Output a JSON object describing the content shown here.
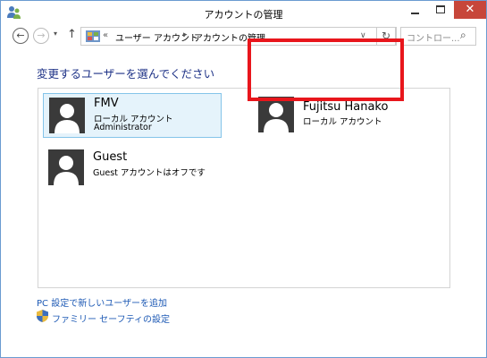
{
  "window": {
    "title": "アカウントの管理",
    "close_glyph": "✕"
  },
  "nav": {
    "back_glyph": "←",
    "forward_glyph": "→",
    "dropdown_glyph": "▾",
    "up_glyph": "↑",
    "breadcrumb_sep": "«",
    "breadcrumb": [
      "ユーザー アカウント",
      "アカウントの管理"
    ],
    "crumb_sep": "▸",
    "address_dropdown": "∨",
    "refresh_glyph": "↻",
    "search_placeholder": "コントロー...",
    "search_glyph": "⌕"
  },
  "main": {
    "heading": "変更するユーザーを選んでください",
    "users": [
      {
        "name": "FMV",
        "type": "ローカル アカウント",
        "role": "Administrator",
        "selected": true
      },
      {
        "name": "Fujitsu Hanako",
        "type": "ローカル アカウント",
        "role": "",
        "highlighted": true
      },
      {
        "name": "Guest",
        "type": "Guest アカウントはオフです",
        "role": ""
      }
    ],
    "links": {
      "add_user": "PC 設定で新しいユーザーを追加",
      "family_safety": "ファミリー セーフティの設定"
    }
  },
  "colors": {
    "heading": "#1e3287",
    "link": "#1e5ab5",
    "selected_bg": "#e5f3fb",
    "selected_border": "#84c4e9",
    "highlight_border": "#e8161c",
    "avatar_bg": "#3a3a3a",
    "close_button": "#c7463a"
  }
}
